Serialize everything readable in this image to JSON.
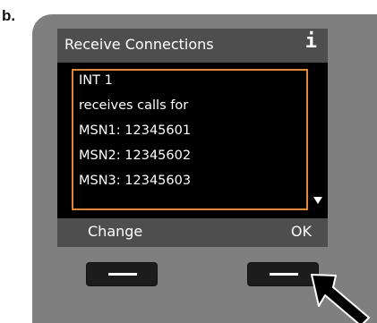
{
  "figure_label": "b.",
  "screen": {
    "title": "Receive Connections",
    "info_icon": "i",
    "lines": [
      "INT 1",
      "receives calls for",
      "MSN1: 12345601",
      "MSN2: 12345602",
      "MSN3: 12345603"
    ]
  },
  "softkeys": {
    "left_label": "Change",
    "right_label": "OK"
  },
  "colors": {
    "accent": "#e3873a",
    "bar": "#4e4e4e",
    "screen_bg": "#000000",
    "housing": "#7f7f7f"
  },
  "icons": {
    "info": "info-icon",
    "scroll": "scroll-down-arrow-icon",
    "pointer": "pointer-arrow-icon"
  }
}
